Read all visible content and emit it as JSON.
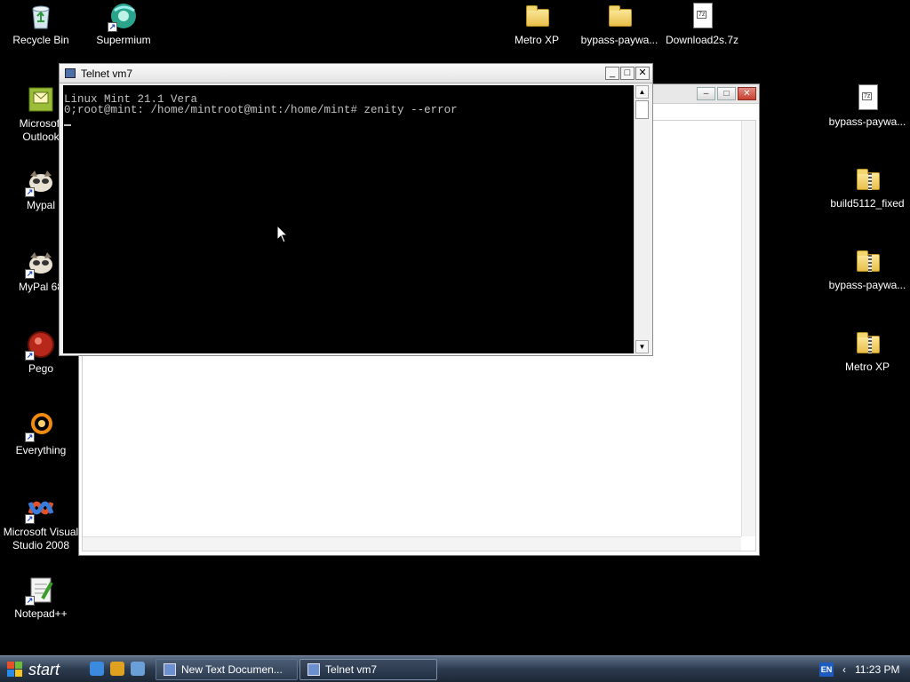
{
  "desktop": {
    "icons": [
      {
        "label": "Recycle Bin",
        "icon": "recycle-bin-icon"
      },
      {
        "label": "Supermium",
        "icon": "supermium-icon"
      },
      {
        "label": "Metro XP",
        "icon": "folder-icon"
      },
      {
        "label": "bypass-paywa...",
        "icon": "folder-icon"
      },
      {
        "label": "Download2s.7z",
        "icon": "archive-file-icon"
      },
      {
        "label": "Microsoft Outlook",
        "icon": "outlook-icon"
      },
      {
        "label": "Mypal",
        "icon": "mypal-icon"
      },
      {
        "label": "MyPal 68",
        "icon": "mypal-icon"
      },
      {
        "label": "Pego",
        "icon": "pego-icon"
      },
      {
        "label": "Everything",
        "icon": "everything-icon"
      },
      {
        "label": "Microsoft Visual Studio 2008",
        "icon": "visual-studio-icon"
      },
      {
        "label": "Notepad++",
        "icon": "notepadpp-icon"
      },
      {
        "label": "bypass-paywa...",
        "icon": "file-icon"
      },
      {
        "label": "build5112_fixed",
        "icon": "zip-folder-icon"
      },
      {
        "label": "bypass-paywa...",
        "icon": "zip-folder-icon"
      },
      {
        "label": "Metro XP",
        "icon": "zip-folder-icon"
      }
    ]
  },
  "telnet_window": {
    "title": "Telnet vm7",
    "lines": [
      "Linux Mint 21.1 Vera",
      "0;root@mint: /home/mintroot@mint:/home/mint# zenity --error"
    ]
  },
  "taskbar": {
    "start_label": "start",
    "buttons": [
      {
        "label": "New Text Documen..."
      },
      {
        "label": "Telnet vm7"
      }
    ],
    "language": "EN",
    "clock": "11:23 PM"
  },
  "colors": {
    "desktop_bg": "#000000",
    "console_bg": "#000000",
    "console_fg": "#c0c0c0",
    "taskbar": "#2c3a4e"
  }
}
